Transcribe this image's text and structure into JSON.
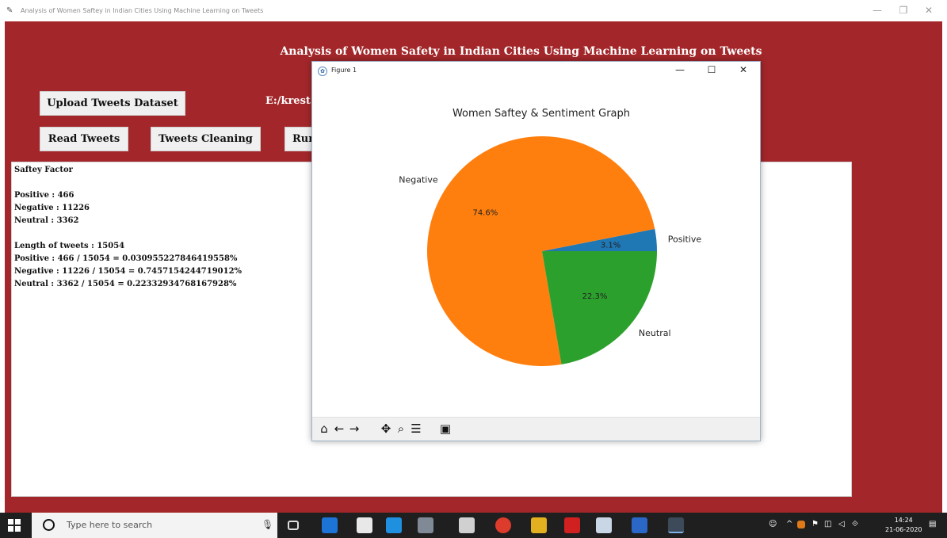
{
  "window": {
    "title": "Analysis of Women Saftey in Indian Cities Using Machine Learning on Tweets",
    "controls": [
      "—",
      "❐",
      "✕"
    ]
  },
  "app": {
    "heading": "Analysis of Women Safety in Indian Cities Using Machine Learning on Tweets",
    "buttons": {
      "upload": "Upload Tweets Dataset",
      "read": "Read Tweets",
      "clean": "Tweets Cleaning",
      "run": "Run"
    },
    "path_label": "E:/krest",
    "text_lines": [
      "Saftey Factor",
      "",
      "Positive : 466",
      "Negative : 11226",
      "Neutral  : 3362",
      "",
      "Length of tweets  : 15054",
      "Positive : 466 / 15054 = 0.030955227846419558%",
      "Negative : 11226 / 15054 = 0.7457154244719012%",
      "Neutral  : 3362 / 15054 = 0.22332934768167928%"
    ]
  },
  "figure": {
    "window_title": "Figure 1",
    "controls": [
      "—",
      "☐",
      "✕"
    ],
    "toolbar": [
      "home-icon",
      "back-icon",
      "forward-icon",
      "pan-icon",
      "zoom-icon",
      "configure-icon",
      "save-icon"
    ]
  },
  "chart_data": {
    "type": "pie",
    "title": "Women Saftey & Sentiment Graph",
    "labels": [
      "Positive",
      "Negative",
      "Neutral"
    ],
    "values": [
      3.1,
      74.6,
      22.3
    ],
    "value_labels": [
      "3.1%",
      "74.6%",
      "22.3%"
    ],
    "colors": [
      "#1f77b4",
      "#ff7f0e",
      "#2ca02c"
    ],
    "startangle": 0,
    "direction": "counterclockwise"
  },
  "taskbar": {
    "search_placeholder": "Type here to search",
    "time": "14:24",
    "date": "21-06-2020"
  },
  "colors": {
    "app_background": "#a3272a",
    "taskbar": "#1f1f1f"
  }
}
